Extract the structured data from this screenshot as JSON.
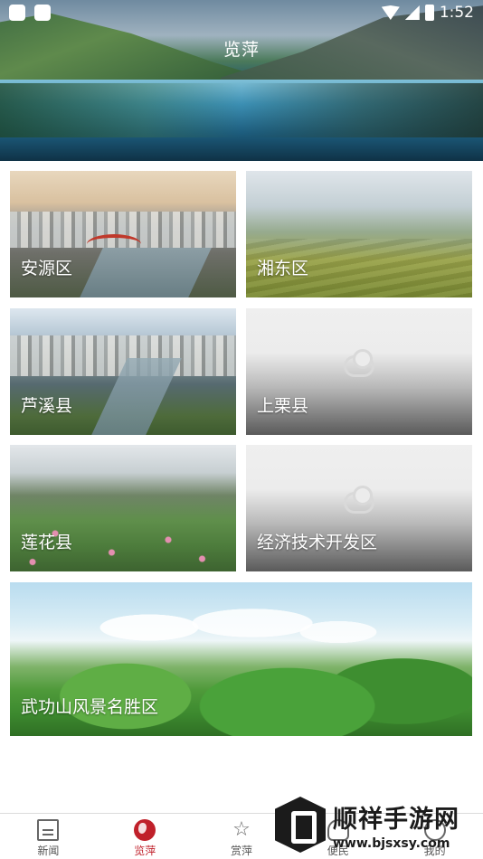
{
  "status_bar": {
    "time": "1:52"
  },
  "header": {
    "title": "览萍"
  },
  "tiles": [
    {
      "label": "安源区"
    },
    {
      "label": "湘东区"
    },
    {
      "label": "芦溪县"
    },
    {
      "label": "上栗县"
    },
    {
      "label": "莲花县"
    },
    {
      "label": "经济技术开发区"
    },
    {
      "label": "武功山风景名胜区"
    }
  ],
  "bottom_nav": {
    "items": [
      {
        "label": "新闻",
        "icon": "news-icon"
      },
      {
        "label": "览萍",
        "icon": "globe-icon"
      },
      {
        "label": "赏萍",
        "icon": "star-icon"
      },
      {
        "label": "便民",
        "icon": "people-icon"
      },
      {
        "label": "我的",
        "icon": "profile-icon"
      }
    ],
    "active_index": 1,
    "active_color": "#c0202a"
  },
  "watermark": {
    "title": "顺祥手游网",
    "url": "www.bjsxsy.com"
  }
}
